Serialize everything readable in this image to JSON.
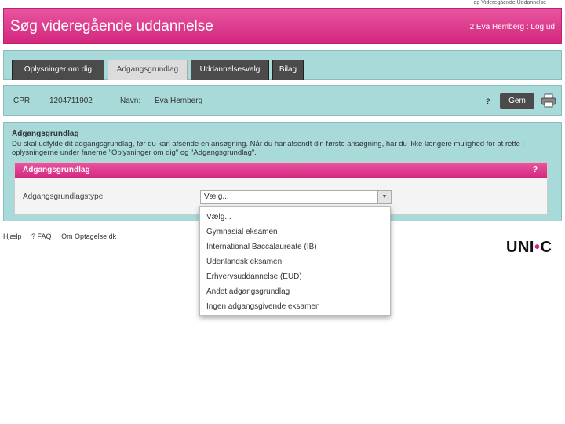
{
  "topline": "dg Videregående Uddannelse",
  "header": {
    "title": "Søg videregående uddannelse",
    "user": "2 Eva Hemberg : Log ud"
  },
  "tabs": [
    {
      "label": "Oplysninger om dig"
    },
    {
      "label": "Adgangsgrundlag"
    },
    {
      "label": "Uddannelsesvalg"
    },
    {
      "label": "Bilag"
    }
  ],
  "info": {
    "cpr_label": "CPR:",
    "cpr_value": "1204711902",
    "name_label": "Navn:",
    "name_value": "Eva Hemberg",
    "help": "?",
    "save": "Gem"
  },
  "section": {
    "heading": "Adgangsgrundlag",
    "description": "Du skal udfylde dit adgangsgrundlag, før du kan afsende en ansøgning. Når du har afsendt din første ansøgning, har du ikke længere mulighed for at rette i oplysningerne under fanerne \"Oplysninger om dig\" og \"Adgangsgrundlag\"."
  },
  "panel": {
    "title": "Adgangsgrundlag",
    "help": "?",
    "field_label": "Adgangsgrundlagstype",
    "selected": "Vælg..."
  },
  "dropdown_options": [
    "Vælg...",
    "Gymnasial eksamen",
    "International Baccalaureate (IB)",
    "Udenlandsk eksamen",
    "Erhvervsuddannelse (EUD)",
    "Andet adgangsgrundlag",
    "Ingen adgangsgivende eksamen"
  ],
  "footer": {
    "help": "Hjælp",
    "faq": "? FAQ",
    "link": "Om Optagelse.dk"
  },
  "logo": {
    "left": "UNI",
    "dot": "•",
    "right": "C"
  },
  "colors": {
    "brand": "#d3277e",
    "teal": "#a9dada",
    "dark_tab": "#4b4b4b"
  }
}
